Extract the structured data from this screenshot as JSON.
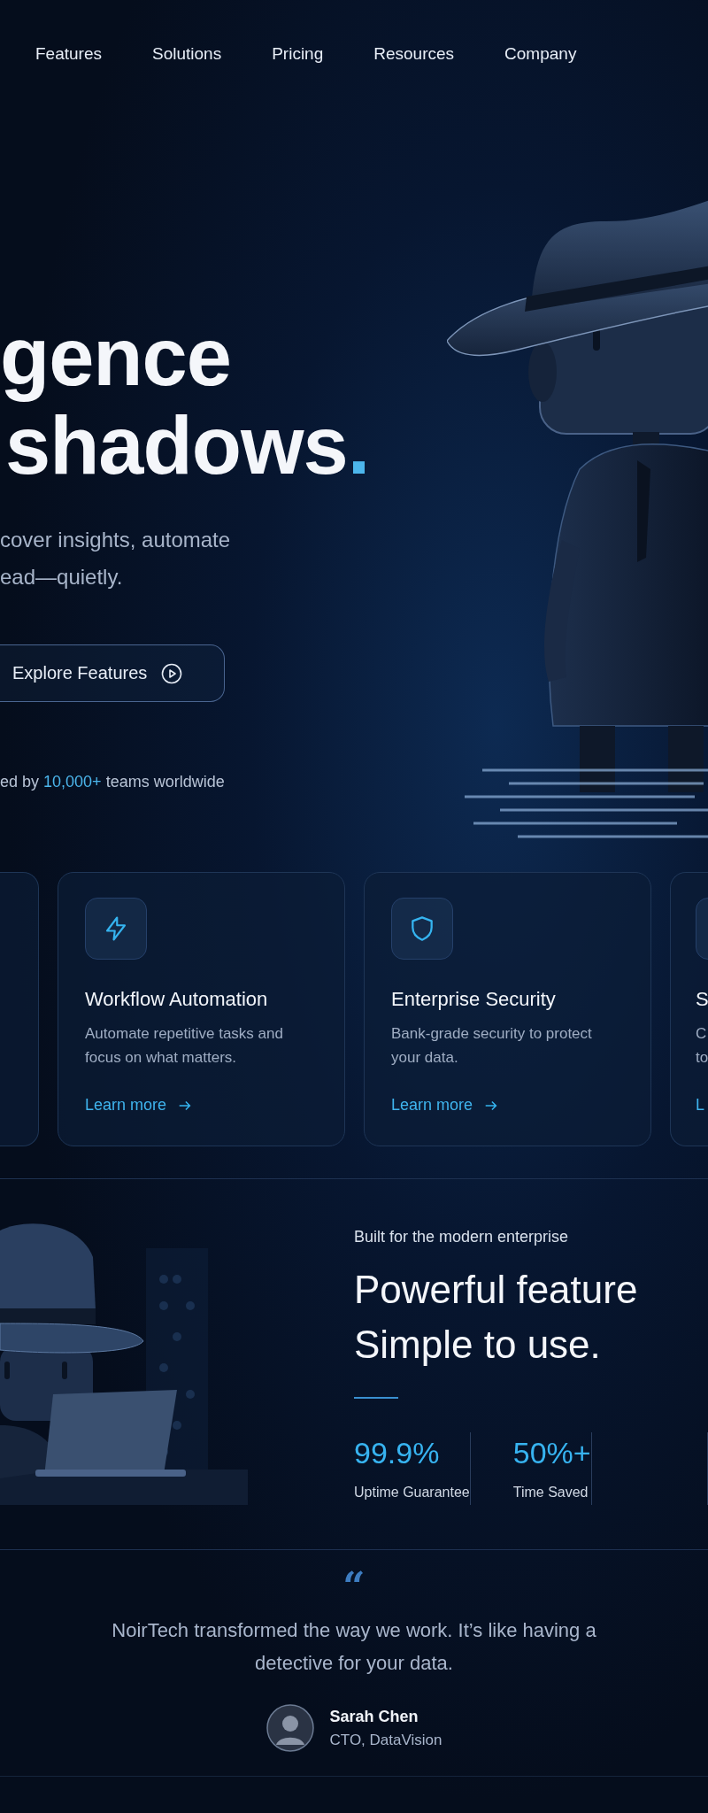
{
  "nav_items": [
    {
      "label": "Features"
    },
    {
      "label": "Solutions"
    },
    {
      "label": "Pricing"
    },
    {
      "label": "Resources"
    },
    {
      "label": "Company"
    }
  ],
  "hero": {
    "headline_lines": [
      "gence",
      "shadows"
    ],
    "headline_accent": ".",
    "subtitle_lines": [
      "cover insights, automate",
      "ead—quietly."
    ],
    "cta_button": {
      "label": "Explore Features"
    },
    "trust": {
      "prefix": "ed by ",
      "highlight": "10,000+",
      "suffix": " teams worldwide"
    }
  },
  "feature_cards": [
    {
      "kind": "edge"
    },
    {
      "kind": "full",
      "title": "Workflow Automation",
      "description": "Automate repetitive tasks and focus on what matters.",
      "link": "Learn more"
    },
    {
      "kind": "full",
      "title": "Enterprise Security",
      "description": "Bank-grade security to protect your data.",
      "link": "Learn more"
    },
    {
      "kind": "cut",
      "title": "S",
      "description_lines": [
        "C",
        "to"
      ],
      "link": "L"
    }
  ],
  "enterprise": {
    "eyebrow": "Built for the modern enterprise",
    "heading_lines": [
      "Powerful feature",
      "Simple to use."
    ],
    "stats": [
      {
        "value": "99.9%",
        "label": "Uptime Guarantee"
      },
      {
        "value": "50%+",
        "label": "Time Saved"
      }
    ]
  },
  "testimonial": {
    "quote_mark": "“",
    "quote": "NoirTech transformed the way we work. It’s like having a detective for your data.",
    "author": {
      "name": "Sarah Chen",
      "role": "CTO, DataVision"
    }
  }
}
